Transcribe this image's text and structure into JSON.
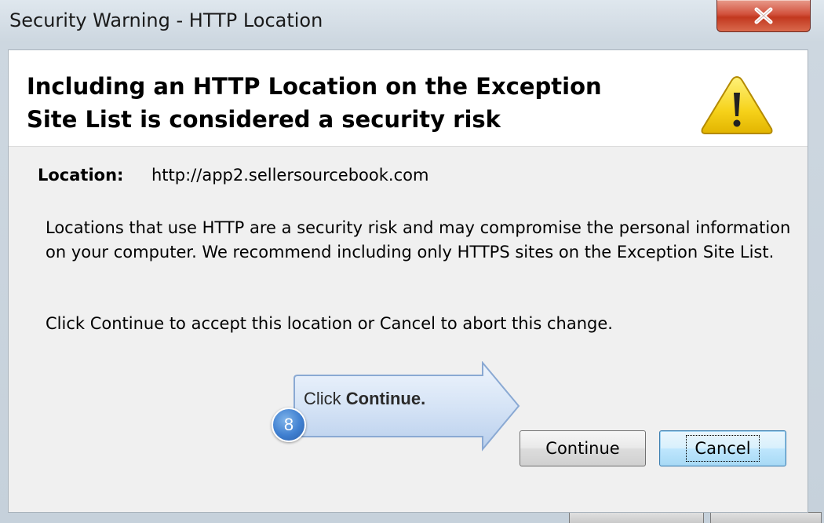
{
  "window": {
    "title": "Security Warning - HTTP Location",
    "close_icon": "close-icon"
  },
  "header": {
    "heading_line1": "Including an HTTP Location on the Exception",
    "heading_line2": "Site List is considered a security risk",
    "icon": "warning-icon",
    "warning_color": "#f6d21a"
  },
  "body": {
    "location_label": "Location:",
    "location_value": "http://app2.sellersourcebook.com",
    "description": "Locations that use HTTP are a security risk and may compromise the personal information on your computer.  We recommend including only HTTPS sites on the Exception Site List.",
    "instruction": "Click Continue to accept this location or Cancel to abort this change."
  },
  "callout": {
    "step_number": "8",
    "text_prefix": "Click ",
    "text_bold": "Continue."
  },
  "buttons": {
    "continue_label": "Continue",
    "cancel_label": "Cancel"
  }
}
